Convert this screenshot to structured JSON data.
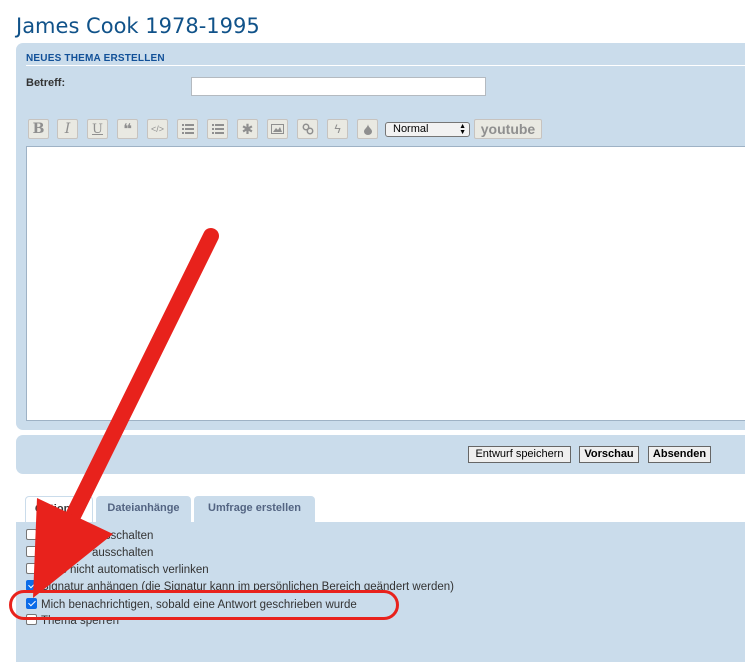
{
  "page": {
    "title": "James Cook 1978-1995"
  },
  "post_form": {
    "heading": "NEUES THEMA ERSTELLEN",
    "subject_label": "Betreff:",
    "subject_value": "",
    "font_size_selected": "Normal",
    "youtube_label": "youtube",
    "toolbar_icons": [
      "bold-icon",
      "italic-icon",
      "underline-icon",
      "quote-icon",
      "code-icon",
      "list-icon",
      "numbered-list-icon",
      "list-item-icon",
      "image-icon",
      "link-icon",
      "flash-icon",
      "color-icon"
    ],
    "toolbar_labels": {
      "bold": "B",
      "italic": "I",
      "underline": "U"
    }
  },
  "actions": {
    "save_draft": "Entwurf speichern",
    "preview": "Vorschau",
    "submit": "Absenden"
  },
  "tabs": [
    {
      "label": "Optionen",
      "active": true
    },
    {
      "label": "Dateianhänge",
      "active": false
    },
    {
      "label": "Umfrage erstellen",
      "active": false
    }
  ],
  "options": [
    {
      "label": "ausschalten",
      "checked": false
    },
    {
      "label": "ausschalten",
      "checked": false
    },
    {
      "label": "s nicht automatisch verlinken",
      "checked": false
    },
    {
      "label": "Signatur anhängen (die Signatur kann im persönlichen Bereich geändert werden)",
      "checked": true
    },
    {
      "label": "Mich benachrichtigen, sobald eine Antwort geschrieben wurde",
      "checked": true
    },
    {
      "label": "Thema sperren",
      "checked": false
    }
  ],
  "annotation": {
    "color": "#e8221c"
  }
}
